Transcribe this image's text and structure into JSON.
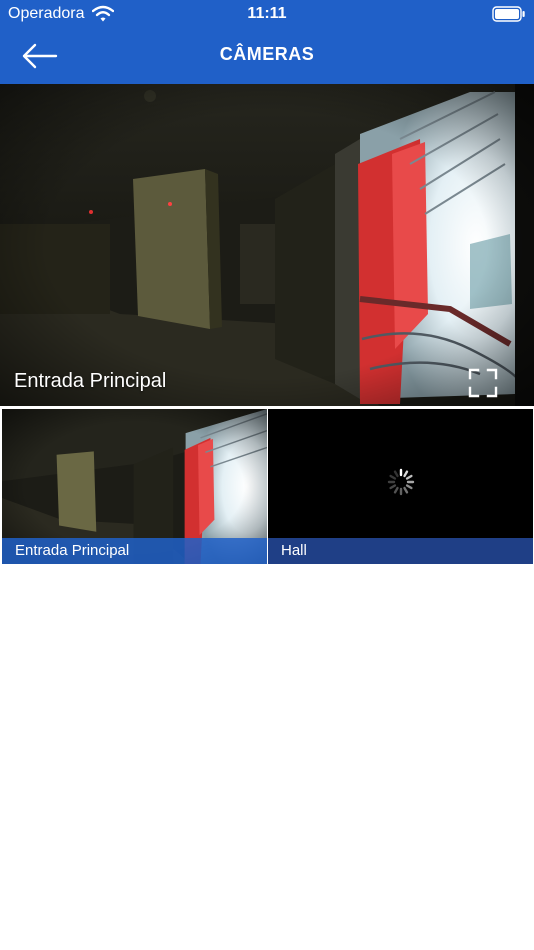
{
  "status_bar": {
    "carrier": "Operadora",
    "time": "11:11"
  },
  "nav": {
    "title": "CÂMERAS"
  },
  "main_camera": {
    "label": "Entrada Principal"
  },
  "cameras": [
    {
      "label": "Entrada Principal",
      "state": "streaming"
    },
    {
      "label": "Hall",
      "state": "loading"
    }
  ],
  "colors": {
    "brand": "#2060c8",
    "tile_label_bg": "#1f3f86",
    "accent_red": "#e02828"
  },
  "icons": [
    "wifi-icon",
    "battery-icon",
    "back-arrow-icon",
    "fullscreen-icon",
    "loading-spinner-icon"
  ]
}
